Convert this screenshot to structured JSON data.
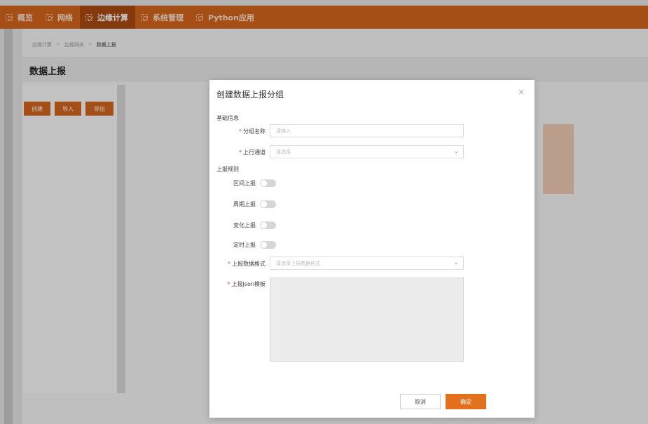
{
  "nav": {
    "items": [
      {
        "label": "概览",
        "active": false
      },
      {
        "label": "网络",
        "active": false
      },
      {
        "label": "边缘计算",
        "active": true
      },
      {
        "label": "系统管理",
        "active": false
      },
      {
        "label": "Python应用",
        "active": false
      }
    ]
  },
  "page": {
    "breadcrumb": [
      "边缘计算",
      "边缘网关",
      "数据上报"
    ],
    "title": "数据上报",
    "buttons": {
      "create": "创建",
      "import": "导入",
      "export": "导出"
    }
  },
  "modal": {
    "title": "创建数据上报分组",
    "close": "×",
    "section_basic": "基础信息",
    "group_name": {
      "label": "分组名称",
      "placeholder": "请输入"
    },
    "uplink": {
      "label": "上行通道",
      "placeholder": "请选择"
    },
    "section_rules": "上报规则",
    "switches": [
      {
        "label": "区间上报"
      },
      {
        "label": "周期上报"
      },
      {
        "label": "变化上报"
      },
      {
        "label": "定时上报"
      }
    ],
    "data_format": {
      "label": "上报数据格式",
      "placeholder": "请选择上报数据格式"
    },
    "json_template": {
      "label": "上报Json模板"
    },
    "cancel": "取消",
    "ok": "确定"
  },
  "colors": {
    "brand": "#d4661e",
    "nav_active": "#a94b11",
    "primary_button": "#e3701c",
    "required_mark": "#e04a2a"
  }
}
